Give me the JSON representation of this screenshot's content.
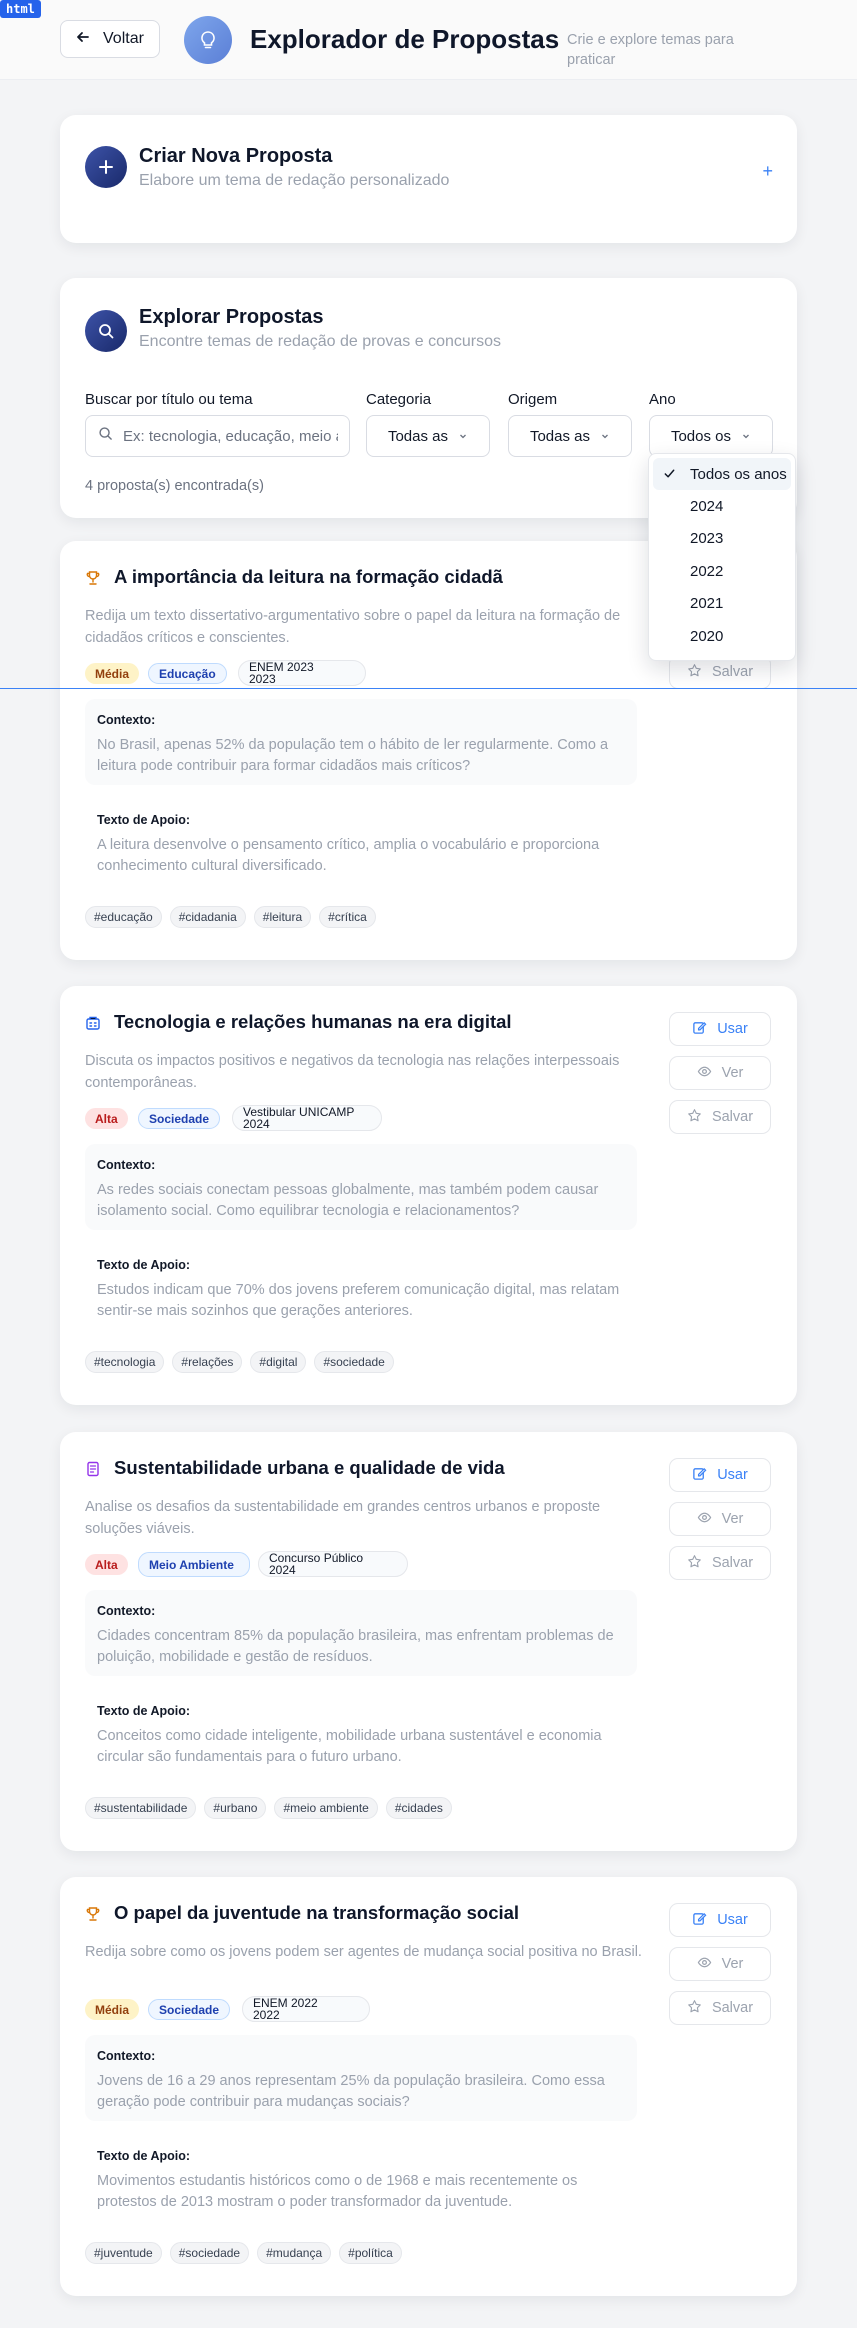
{
  "dev_tag": "html",
  "header": {
    "back_label": "Voltar",
    "title": "Explorador de Propostas",
    "subtitle": "Crie e explore temas para praticar"
  },
  "create": {
    "title": "Criar Nova Proposta",
    "subtitle": "Elabore um tema de redação personalizado",
    "plus": "+"
  },
  "explore": {
    "title": "Explorar Propostas",
    "subtitle": "Encontre temas de redação de provas e concursos",
    "search_label": "Buscar por título ou tema",
    "search_placeholder": "Ex: tecnologia, educação, meio ambiente...",
    "categoria_label": "Categoria",
    "categoria_value": "Todas as",
    "origem_label": "Origem",
    "origem_value": "Todas as",
    "ano_label": "Ano",
    "ano_value": "Todos os",
    "count": "4 proposta(s) encontrada(s)"
  },
  "year_dropdown": {
    "options": [
      "Todos os anos",
      "2024",
      "2023",
      "2022",
      "2021",
      "2020"
    ],
    "selected": "Todos os anos"
  },
  "actions": {
    "use": "Usar",
    "view": "Ver",
    "save": "Salvar"
  },
  "labels": {
    "context": "Contexto:",
    "support": "Texto de Apoio:"
  },
  "proposals": [
    {
      "icon": "trophy-icon",
      "title": "A importância da leitura na formação cidadã",
      "description": "Redija um texto dissertativo-argumentativo sobre o papel da leitura na formação de cidadãos críticos e conscientes.",
      "difficulty": "Média",
      "category": "Educação",
      "origin_name": "ENEM 2023",
      "origin_year": "2023",
      "context": "No Brasil, apenas 52% da população tem o hábito de ler regularmente. Como a leitura pode contribuir para formar cidadãos mais críticos?",
      "support": "A leitura desenvolve o pensamento crítico, amplia o vocabulário e proporciona conhecimento cultural diversificado.",
      "tags": [
        "#educação",
        "#cidadania",
        "#leitura",
        "#crítica"
      ]
    },
    {
      "icon": "building-icon",
      "title": "Tecnologia e relações humanas na era digital",
      "description": "Discuta os impactos positivos e negativos da tecnologia nas relações interpessoais contemporâneas.",
      "difficulty": "Alta",
      "category": "Sociedade",
      "origin_name": "Vestibular UNICAMP",
      "origin_year": "2024",
      "context": "As redes sociais conectam pessoas globalmente, mas também podem causar isolamento social. Como equilibrar tecnologia e relacionamentos?",
      "support": "Estudos indicam que 70% dos jovens preferem comunicação digital, mas relatam sentir-se mais sozinhos que gerações anteriores.",
      "tags": [
        "#tecnologia",
        "#relações",
        "#digital",
        "#sociedade"
      ]
    },
    {
      "icon": "document-icon",
      "title": "Sustentabilidade urbana e qualidade de vida",
      "description": "Analise os desafios da sustentabilidade em grandes centros urbanos e proposte soluções viáveis.",
      "difficulty": "Alta",
      "category": "Meio Ambiente",
      "origin_name": "Concurso Público",
      "origin_year": "2024",
      "context": "Cidades concentram 85% da população brasileira, mas enfrentam problemas de poluição, mobilidade e gestão de resíduos.",
      "support": "Conceitos como cidade inteligente, mobilidade urbana sustentável e economia circular são fundamentais para o futuro urbano.",
      "tags": [
        "#sustentabilidade",
        "#urbano",
        "#meio ambiente",
        "#cidades"
      ]
    },
    {
      "icon": "trophy-icon",
      "title": "O papel da juventude na transformação social",
      "description": "Redija sobre como os jovens podem ser agentes de mudança social positiva no Brasil.",
      "difficulty": "Média",
      "category": "Sociedade",
      "origin_name": "ENEM 2022",
      "origin_year": "2022",
      "context": "Jovens de 16 a 29 anos representam 25% da população brasileira. Como essa geração pode contribuir para mudanças sociais?",
      "support": "Movimentos estudantis históricos como o de 1968 e mais recentemente os protestos de 2013 mostram o poder transformador da juventude.",
      "tags": [
        "#juventude",
        "#sociedade",
        "#mudança",
        "#política"
      ]
    }
  ]
}
